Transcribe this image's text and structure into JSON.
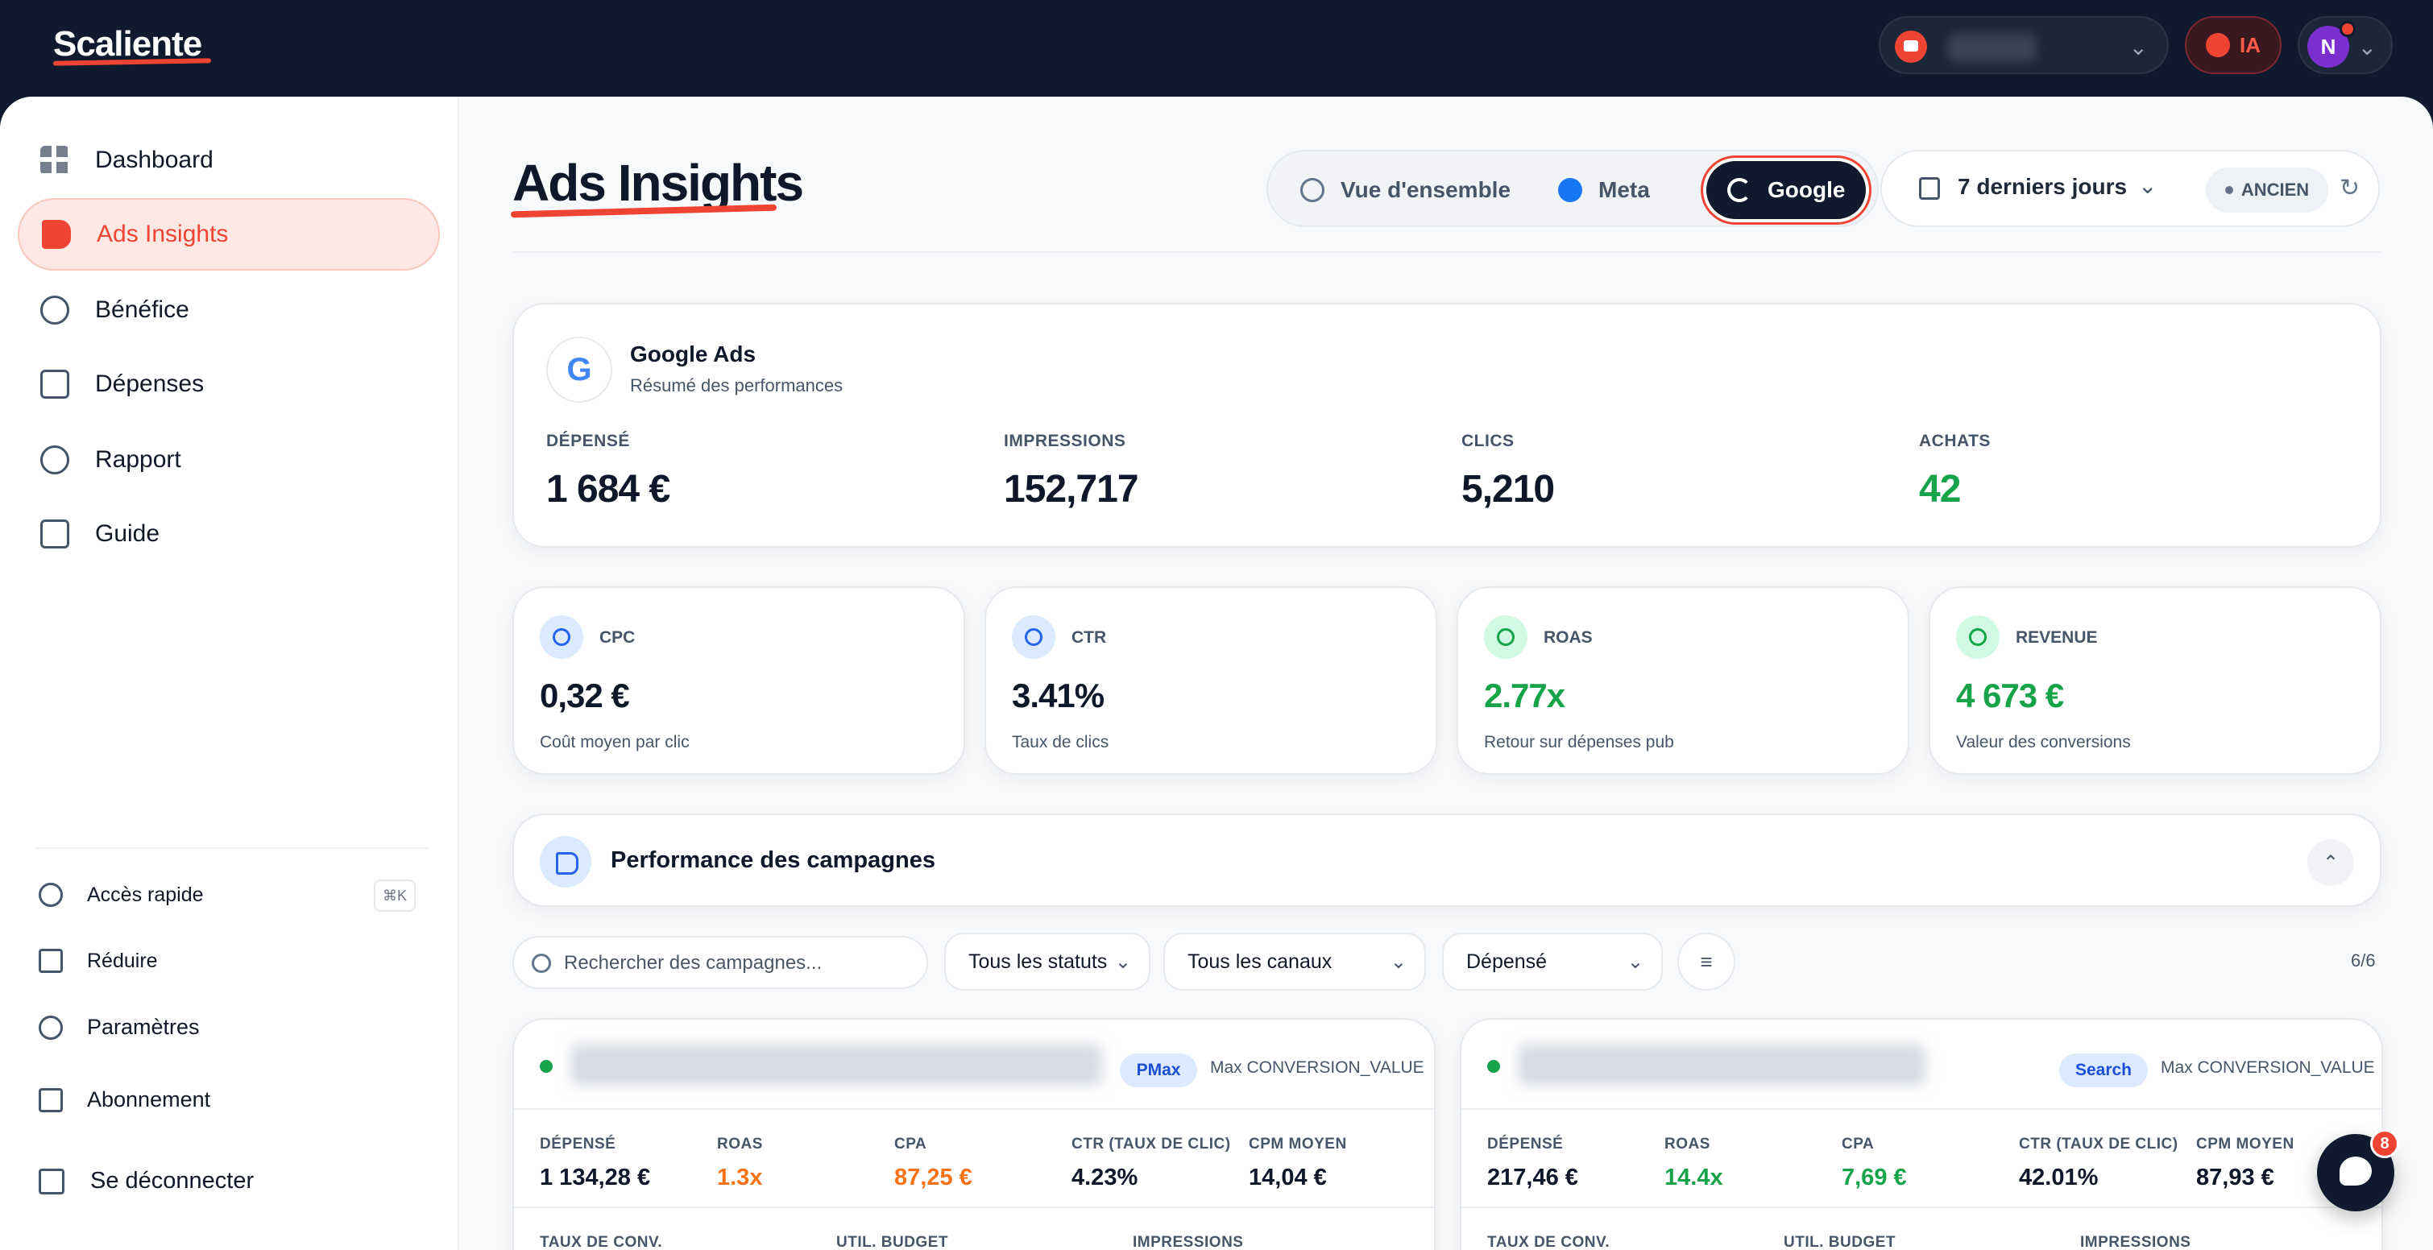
{
  "app": {
    "logo": "Scaliente",
    "ia_label": "IA",
    "user_initial": "N"
  },
  "sidebar": {
    "items": [
      {
        "label": "Dashboard",
        "icon": "grid-icon"
      },
      {
        "label": "Ads Insights",
        "icon": "megaphone-icon",
        "active": true
      },
      {
        "label": "Bénéfice",
        "icon": "piggy-bank-icon"
      },
      {
        "label": "Dépenses",
        "icon": "receipt-icon"
      },
      {
        "label": "Rapport",
        "icon": "pie-chart-icon"
      },
      {
        "label": "Guide",
        "icon": "book-icon"
      }
    ],
    "quick_access": "Accès rapide",
    "quick_access_kbd": "⌘K",
    "collapse": "Réduire",
    "settings": "Paramètres",
    "subscription": "Abonnement",
    "logout": "Se déconnecter"
  },
  "header": {
    "title": "Ads Insights",
    "tabs": [
      {
        "label": "Vue d'ensemble"
      },
      {
        "label": "Meta"
      },
      {
        "label": "Google",
        "active": true
      }
    ],
    "date_range": "7 derniers jours",
    "ancien": "ANCIEN"
  },
  "google_card": {
    "title": "Google Ads",
    "subtitle": "Résumé des performances",
    "kpis": [
      {
        "label": "DÉPENSÉ",
        "value": "1 684 €"
      },
      {
        "label": "IMPRESSIONS",
        "value": "152,717"
      },
      {
        "label": "CLICS",
        "value": "5,210"
      },
      {
        "label": "ACHATS",
        "value": "42"
      }
    ]
  },
  "metrics": [
    {
      "label": "CPC",
      "value": "0,32 €",
      "desc": "Coût moyen par clic",
      "icon": "cursor-icon"
    },
    {
      "label": "CTR",
      "value": "3.41%",
      "desc": "Taux de clics",
      "icon": "eye-icon"
    },
    {
      "label": "ROAS",
      "value": "2.77x",
      "desc": "Retour sur dépenses pub",
      "icon": "target-icon"
    },
    {
      "label": "REVENUE",
      "value": "4 673 €",
      "desc": "Valeur des conversions",
      "icon": "dollar-icon"
    }
  ],
  "performance": {
    "title": "Performance des campagnes",
    "search_placeholder": "Rechercher des campagnes...",
    "status_filter": "Tous les statuts",
    "channel_filter": "Tous les canaux",
    "sort_by": "Dépensé",
    "count": "6/6"
  },
  "campaigns": [
    {
      "badge": "PMax",
      "bid": "Max CONVERSION_VALUE",
      "stats": [
        {
          "label": "DÉPENSÉ",
          "value": "1 134,28 €"
        },
        {
          "label": "ROAS",
          "value": "1.3x"
        },
        {
          "label": "CPA",
          "value": "87,25 €"
        },
        {
          "label": "CTR (TAUX DE CLIC)",
          "value": "4.23%"
        },
        {
          "label": "CPM MOYEN",
          "value": "14,04 €"
        }
      ],
      "stats2": [
        {
          "label": "TAUX DE CONV."
        },
        {
          "label": "UTIL. BUDGET"
        },
        {
          "label": "IMPRESSIONS"
        }
      ]
    },
    {
      "badge": "Search",
      "bid": "Max CONVERSION_VALUE",
      "stats": [
        {
          "label": "DÉPENSÉ",
          "value": "217,46 €"
        },
        {
          "label": "ROAS",
          "value": "14.4x"
        },
        {
          "label": "CPA",
          "value": "7,69 €"
        },
        {
          "label": "CTR (TAUX DE CLIC)",
          "value": "42.01%"
        },
        {
          "label": "CPM MOYEN",
          "value": "87,93 €"
        }
      ],
      "stats2": [
        {
          "label": "TAUX DE CONV."
        },
        {
          "label": "UTIL. BUDGET"
        },
        {
          "label": "IMPRESSIONS"
        }
      ]
    }
  ],
  "chat": {
    "badge": "8"
  }
}
